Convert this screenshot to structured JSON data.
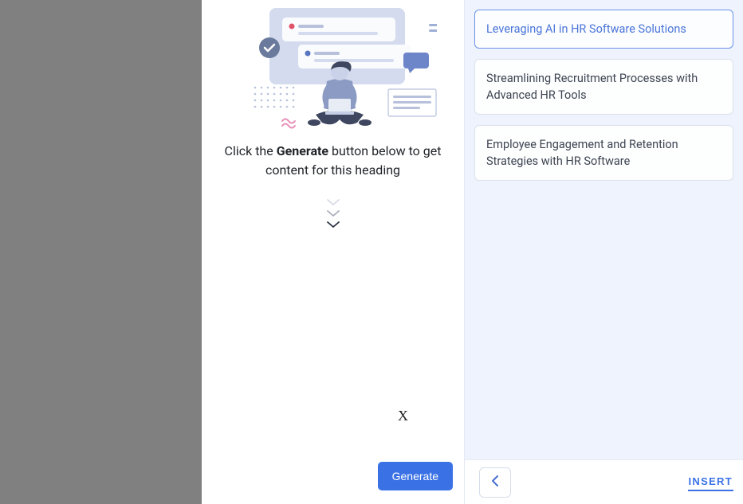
{
  "center": {
    "hint_prefix": "Click the ",
    "hint_bold": "Generate",
    "hint_suffix": " button below to get content for this heading",
    "generate_label": "Generate",
    "x_mark": "X"
  },
  "right": {
    "topics": [
      {
        "label": "Leveraging AI in HR Software Solutions",
        "active": true
      },
      {
        "label": "Streamlining Recruitment Processes with Advanced HR Tools",
        "active": false
      },
      {
        "label": "Employee Engagement and Retention Strategies with HR Software",
        "active": false
      }
    ],
    "insert_label": "INSERT"
  },
  "icons": {
    "checkmark": "checkmark-circle-icon",
    "chevron_down": "chevron-down-icon",
    "chevron_left": "chevron-left-icon"
  }
}
